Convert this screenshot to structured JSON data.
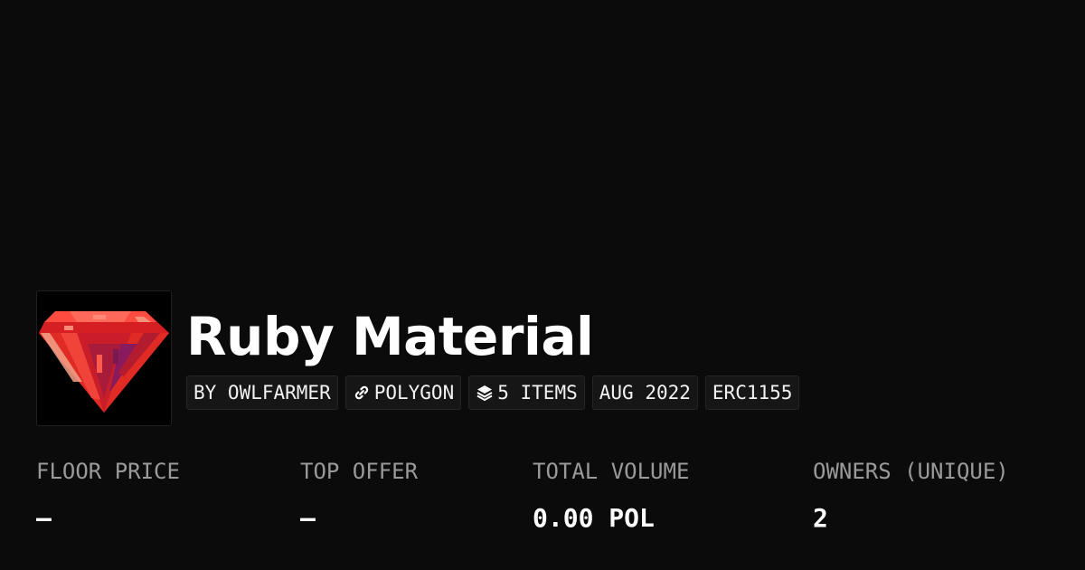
{
  "collection": {
    "name": "Ruby Material",
    "image_icon": "ruby-gem-icon",
    "image_colors": [
      "#e8241f",
      "#ff5a4a",
      "#b31b2e",
      "#8a1a5e",
      "#f2a28a"
    ]
  },
  "chips": {
    "creator": "BY OWLFARMER",
    "chain_icon": "polygon-link-icon",
    "chain": "POLYGON",
    "items_icon": "layers-icon",
    "items": "5 ITEMS",
    "date": "AUG 2022",
    "standard": "ERC1155"
  },
  "stats": [
    {
      "label": "FLOOR PRICE",
      "value": "—"
    },
    {
      "label": "TOP OFFER",
      "value": "—"
    },
    {
      "label": "TOTAL VOLUME",
      "value": "0.00 POL"
    },
    {
      "label": "OWNERS (UNIQUE)",
      "value": "2"
    }
  ],
  "colors": {
    "background": "#0b0b0b",
    "label_gray": "#9a9a9a",
    "chip_background": "#161616"
  }
}
